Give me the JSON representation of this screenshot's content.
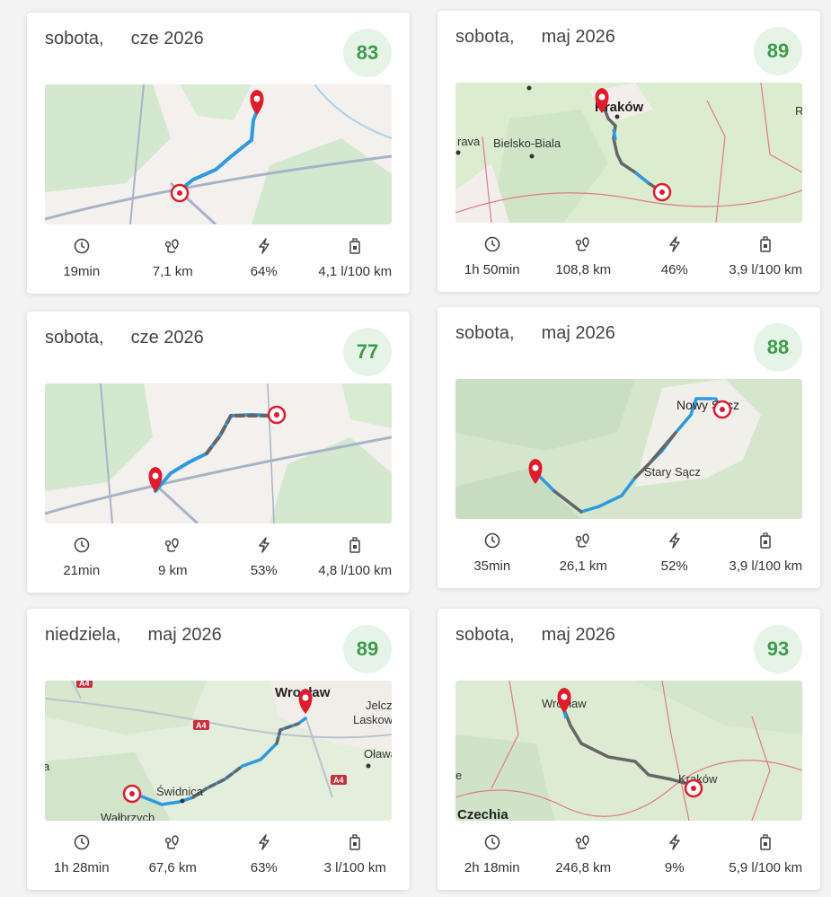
{
  "colors": {
    "score_bg": "#e6f4e8",
    "score_text": "#3f9b4a",
    "route_blue": "#2b9ae0",
    "route_gray": "#666666",
    "pin_red": "#e01b2b"
  },
  "trips": [
    {
      "day": "sobota,",
      "month": "cze 2026",
      "score": "83",
      "duration": "19min",
      "distance": "7,1 km",
      "electric": "64%",
      "consumption": "4,1 l/100 km",
      "map_labels": []
    },
    {
      "day": "sobota,",
      "month": "maj 2026",
      "score": "89",
      "duration": "1h 50min",
      "distance": "108,8 km",
      "electric": "46%",
      "consumption": "3,9 l/100 km",
      "map_labels": [
        "Kraków",
        "Bielsko-Biala",
        "rava",
        "R"
      ]
    },
    {
      "day": "sobota,",
      "month": "cze 2026",
      "score": "77",
      "duration": "21min",
      "distance": "9 km",
      "electric": "53%",
      "consumption": "4,8 l/100 km",
      "map_labels": []
    },
    {
      "day": "sobota,",
      "month": "maj 2026",
      "score": "88",
      "duration": "35min",
      "distance": "26,1 km",
      "electric": "52%",
      "consumption": "3,9 l/100 km",
      "map_labels": [
        "Nowy Sącz",
        "Stary Sącz"
      ]
    },
    {
      "day": "niedziela,",
      "month": "maj 2026",
      "score": "89",
      "duration": "1h 28min",
      "distance": "67,6 km",
      "electric": "63%",
      "consumption": "3 l/100 km",
      "map_labels": [
        "Wrocław",
        "Jelcz-Laskow",
        "Oława",
        "Świdnica",
        "Wałbrzych",
        "A4",
        "A4",
        "A4",
        "a"
      ]
    },
    {
      "day": "sobota,",
      "month": "maj 2026",
      "score": "93",
      "duration": "2h 18min",
      "distance": "246,8 km",
      "electric": "9%",
      "consumption": "5,9 l/100 km",
      "map_labels": [
        "Wrocław",
        "Kraków",
        "Czechia",
        "e"
      ]
    }
  ],
  "icons": {
    "duration": "clock-icon",
    "distance": "route-pin-icon",
    "electric": "lightning-icon",
    "consumption": "fuel-pump-icon"
  }
}
